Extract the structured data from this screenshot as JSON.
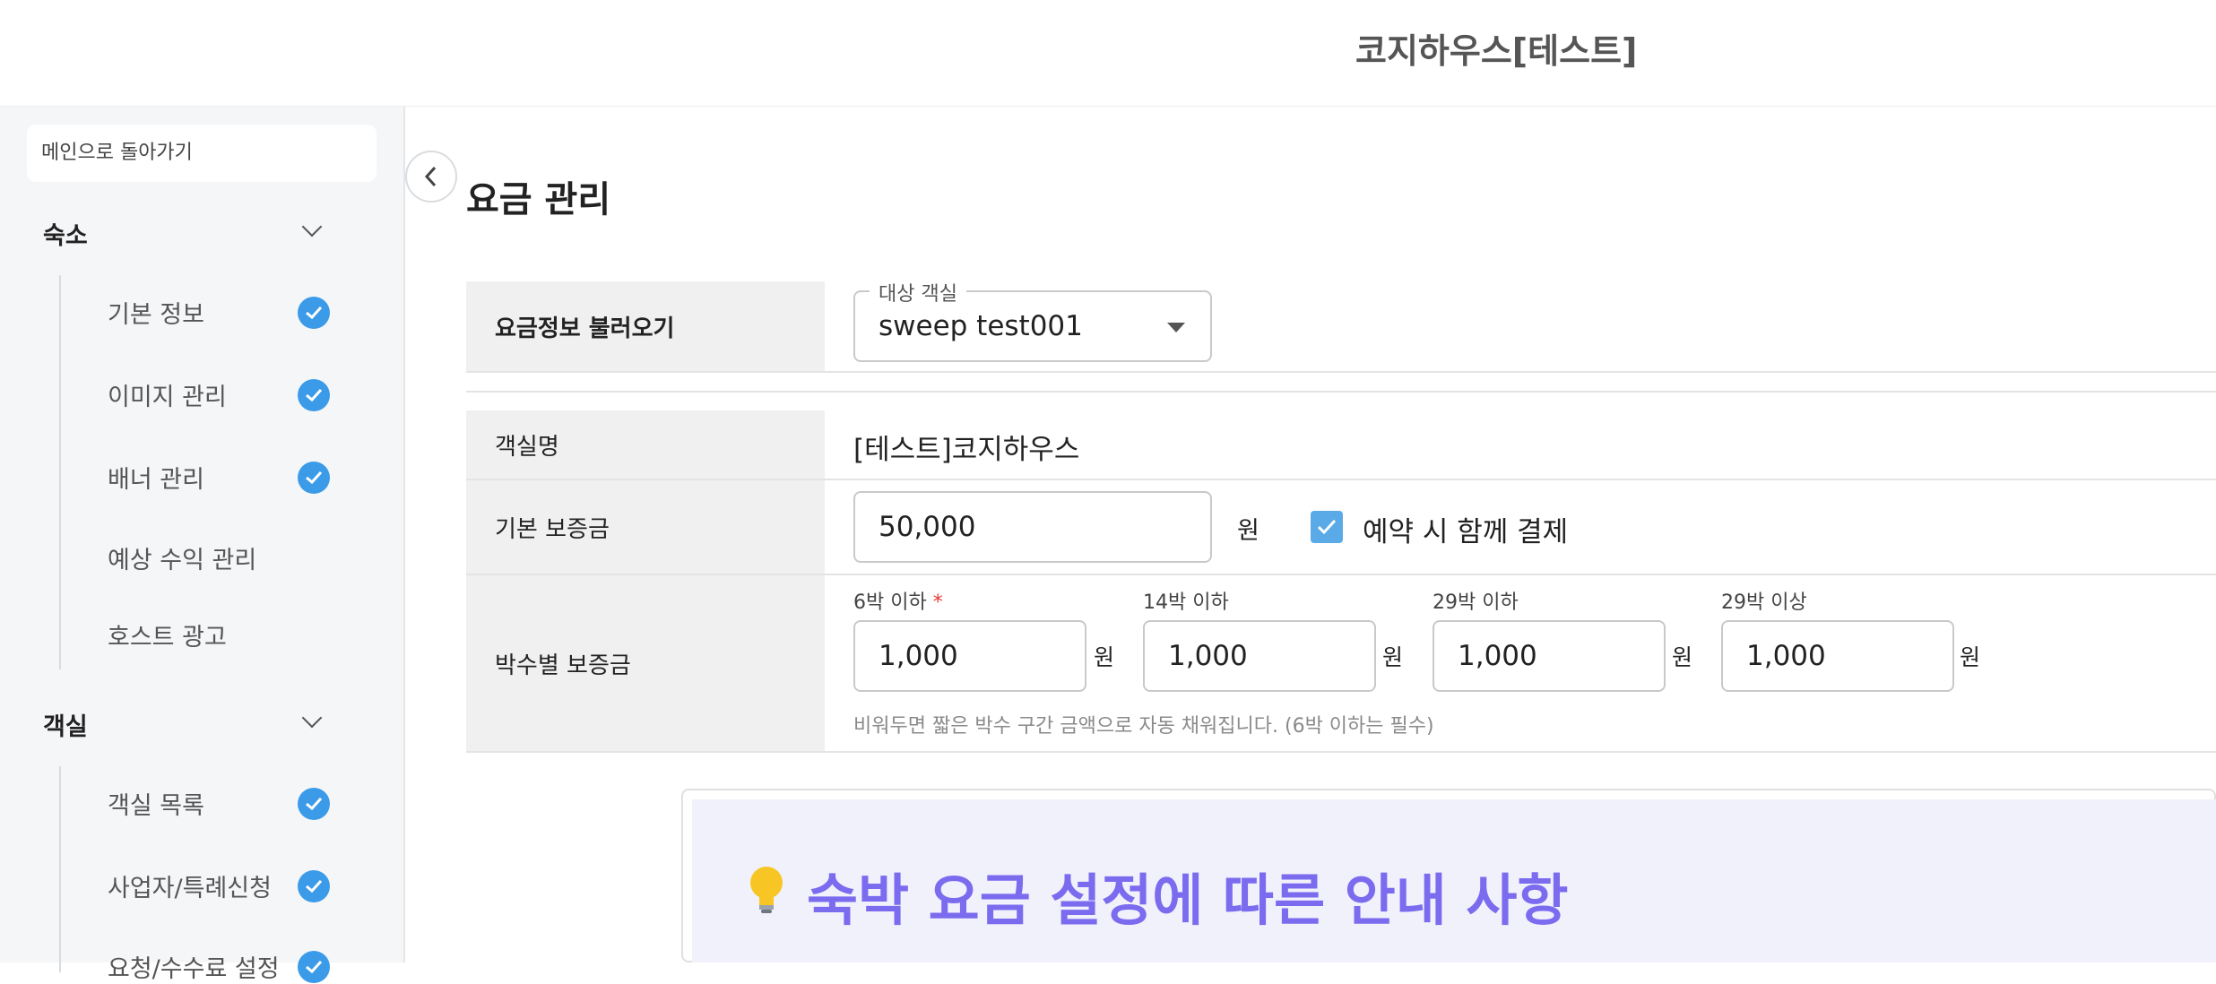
{
  "header": {
    "title": "코지하우스[테스트]"
  },
  "sidebar": {
    "back_label": "메인으로 돌아가기",
    "sections": [
      {
        "label": "숙소",
        "items": [
          {
            "label": "기본 정보",
            "done": true
          },
          {
            "label": "이미지 관리",
            "done": true
          },
          {
            "label": "배너 관리",
            "done": true
          },
          {
            "label": "예상 수익 관리",
            "done": false
          },
          {
            "label": "호스트 광고",
            "done": false
          }
        ]
      },
      {
        "label": "객실",
        "items": [
          {
            "label": "객실 목록",
            "done": true
          },
          {
            "label": "사업자/특례신청",
            "done": true
          },
          {
            "label": "요청/수수료 설정",
            "done": true
          }
        ]
      }
    ]
  },
  "main": {
    "page_title": "요금 관리",
    "load_row": {
      "label": "요금정보 불러오기",
      "select_label": "대상 객실",
      "select_value": "sweep test001"
    },
    "room_name": {
      "label": "객실명",
      "value": "[테스트]코지하우스"
    },
    "base_deposit": {
      "label": "기본 보증금",
      "value": "50,000",
      "unit": "원",
      "checkbox_label": "예약 시 함께 결제",
      "checked": true
    },
    "night_deposit": {
      "label": "박수별 보증금",
      "fields": [
        {
          "label": "6박 이하",
          "required": "*",
          "value": "1,000",
          "unit": "원"
        },
        {
          "label": "14박 이하",
          "value": "1,000",
          "unit": "원"
        },
        {
          "label": "29박 이하",
          "value": "1,000",
          "unit": "원"
        },
        {
          "label": "29박 이상",
          "value": "1,000",
          "unit": "원"
        }
      ],
      "help": "비워두면 짧은 박수 구간 금액으로 자동 채워집니다. (6박 이하는 필수)"
    },
    "notice": {
      "title": "숙박 요금 설정에 따른 안내 사항",
      "icon": "lightbulb-icon"
    }
  },
  "colors": {
    "accent": "#3b9be8",
    "notice": "#7b6bef"
  }
}
